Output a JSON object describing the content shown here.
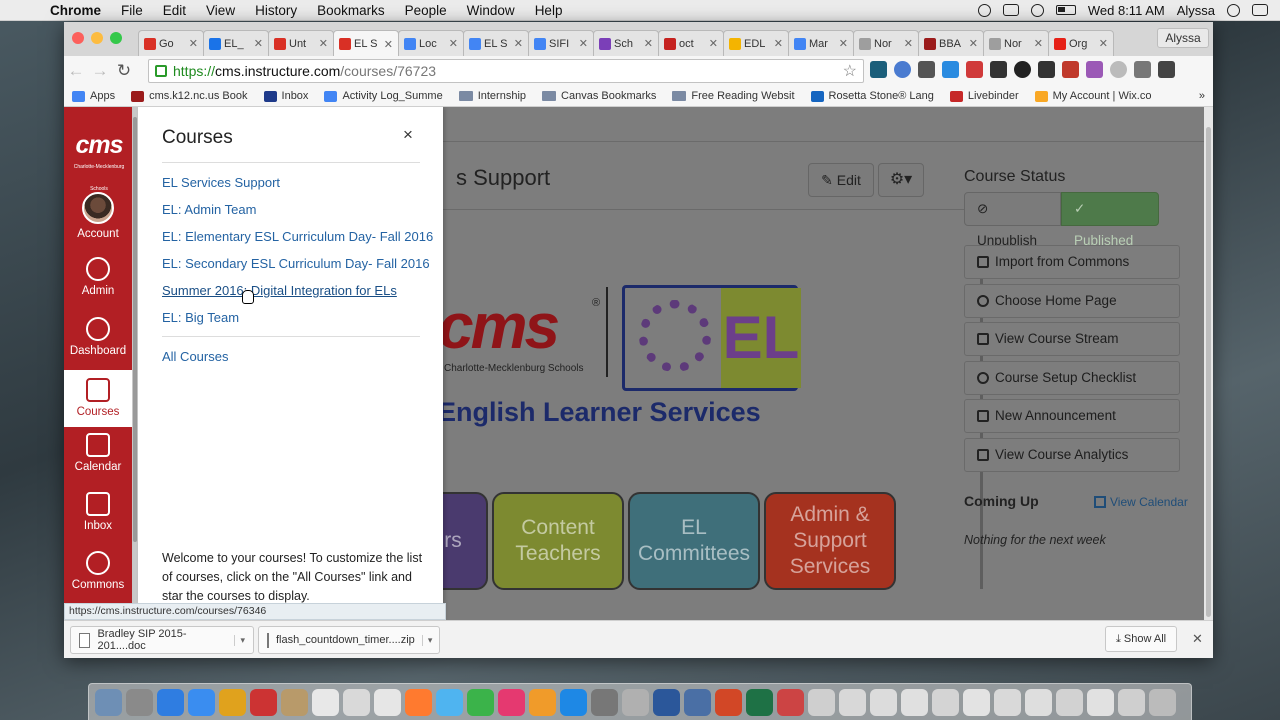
{
  "menubar": {
    "app": "Chrome",
    "items": [
      "File",
      "Edit",
      "View",
      "History",
      "Bookmarks",
      "People",
      "Window",
      "Help"
    ],
    "clock": "Wed 8:11 AM",
    "user": "Alyssa"
  },
  "browser": {
    "profile": "Alyssa",
    "tabs": [
      {
        "label": "Go",
        "color": "#d93025"
      },
      {
        "label": "EL_",
        "color": "#1a73e8"
      },
      {
        "label": "Unt",
        "color": "#d93025"
      },
      {
        "label": "EL S",
        "color": "#d93025",
        "active": true
      },
      {
        "label": "Loc",
        "color": "#4285f4"
      },
      {
        "label": "EL S",
        "color": "#4285f4"
      },
      {
        "label": "SIFI",
        "color": "#4285f4"
      },
      {
        "label": "Sch",
        "color": "#7b3fb8"
      },
      {
        "label": "oct",
        "color": "#c5221f"
      },
      {
        "label": "EDL",
        "color": "#f4b400"
      },
      {
        "label": "Mar",
        "color": "#4285f4"
      },
      {
        "label": "Nor",
        "color": "#9e9e9e"
      },
      {
        "label": "BBA",
        "color": "#9b1b1b"
      },
      {
        "label": "Nor",
        "color": "#9e9e9e"
      },
      {
        "label": "Org",
        "color": "#e62117"
      }
    ],
    "url": {
      "scheme": "https://",
      "host": "cms.instructure.com",
      "path": "/courses/76723"
    },
    "bookmarks": [
      {
        "label": "Apps",
        "color": "#4285f4"
      },
      {
        "label": "cms.k12.nc.us Book",
        "color": "#9b1b1b"
      },
      {
        "label": "Inbox",
        "color": "#1e3a8a"
      },
      {
        "label": "Activity Log_Summe",
        "color": "#4285f4"
      },
      {
        "label": "Internship",
        "folder": true
      },
      {
        "label": "Canvas Bookmarks",
        "folder": true
      },
      {
        "label": "Free Reading Websit",
        "folder": true
      },
      {
        "label": "Rosetta Stone® Lang",
        "color": "#1565c0"
      },
      {
        "label": "Livebinder",
        "color": "#c62828"
      },
      {
        "label": "My Account | Wix.co",
        "color": "#f9a825"
      }
    ]
  },
  "global_nav": {
    "logo": "cms",
    "logo_sub": "Charlotte-Mecklenburg Schools",
    "items": [
      {
        "label": "Account"
      },
      {
        "label": "Admin"
      },
      {
        "label": "Dashboard"
      },
      {
        "label": "Courses"
      },
      {
        "label": "Calendar"
      },
      {
        "label": "Inbox"
      },
      {
        "label": "Commons"
      }
    ]
  },
  "tray": {
    "title": "Courses",
    "close": "×",
    "courses": [
      "EL Services Support",
      "EL: Admin Team",
      "EL: Elementary ESL Curriculum Day- Fall 2016",
      "EL: Secondary ESL Curriculum Day- Fall 2016",
      "Summer 2016: Digital Integration for ELs",
      "EL: Big Team"
    ],
    "all_courses": "All Courses",
    "welcome": "Welcome to your courses! To customize the list of courses, click on the \"All Courses\" link and star the courses to display."
  },
  "course": {
    "title_visible": "s Support",
    "edit": "Edit",
    "banner_brand": "cms",
    "banner_reg": "®",
    "banner_sub": "Charlotte-Mecklenburg Schools",
    "banner_el": "EL",
    "banner_services": "English Learner Services",
    "tiles": [
      {
        "label": "rs",
        "color": "#4a3a6e"
      },
      {
        "label": "Content Teachers",
        "color": "#7d8a30"
      },
      {
        "label": "EL Committees",
        "color": "#3f6f7a"
      },
      {
        "label": "Admin & Support Services",
        "color": "#a5321f"
      }
    ]
  },
  "sidebar": {
    "status_title": "Course Status",
    "unpublish": "Unpublish",
    "published": "Published",
    "actions": [
      "Import from Commons",
      "Choose Home Page",
      "View Course Stream",
      "Course Setup Checklist",
      "New Announcement",
      "View Course Analytics"
    ],
    "coming_up": "Coming Up",
    "view_calendar": "View Calendar",
    "nothing": "Nothing for the next week"
  },
  "status_url": "https://cms.instructure.com/courses/76346",
  "downloads": {
    "items": [
      "Bradley SIP 2015-201....doc",
      "flash_countdown_timer....zip"
    ],
    "show_all": "Show All"
  },
  "dock_colors": [
    "#6e8fb5",
    "#8a8a8a",
    "#2f7de1",
    "#3a8df0",
    "#e0a21d",
    "#c33",
    "#b89a6a",
    "#e8e8e8",
    "#d9d9d9",
    "#e6e6e6",
    "#ff7a2f",
    "#4fb4f0",
    "#3bb34a",
    "#e53970",
    "#f09b2a",
    "#1e88e5",
    "#777",
    "#b0b0b0",
    "#2b579a",
    "#4a6fa5",
    "#d24726",
    "#1e7145",
    "#c44",
    "#cfcfcf",
    "#d8d8d8",
    "#dcdcdc",
    "#e0e0e0",
    "#d4d4d4",
    "#e3e3e3",
    "#d9d9d9",
    "#dedede",
    "#d2d2d2",
    "#e1e1e1",
    "#cfcfcf",
    "#bbbbbb"
  ]
}
